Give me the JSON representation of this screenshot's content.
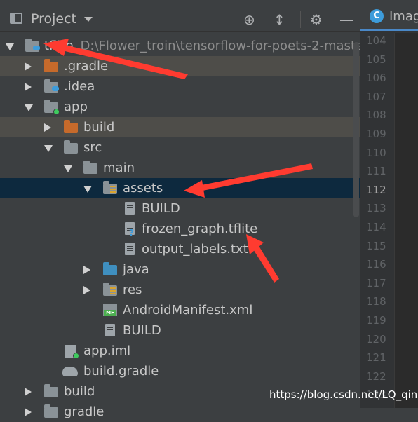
{
  "toolbar": {
    "title": "Project",
    "icons": [
      "view-icon",
      "locate-icon",
      "collapse-icon",
      "gear-icon",
      "minimize-icon"
    ]
  },
  "tree": {
    "root": {
      "label": "tflite",
      "path": "D:\\Flower_troin\\tensorflow-for-poets-2-maste"
    },
    "gradle_dir": ".gradle",
    "idea_dir": ".idea",
    "app": "app",
    "app_build": "build",
    "src": "src",
    "main": "main",
    "assets": "assets",
    "assets_build": "BUILD",
    "frozen_graph": "frozen_graph.tflite",
    "output_labels": "output_labels.txt",
    "java": "java",
    "res": "res",
    "manifest": "AndroidManifest.xml",
    "main_build": "BUILD",
    "app_iml": "app.iml",
    "build_gradle": "build.gradle",
    "root_build": "build",
    "gradle_partial": "gradle"
  },
  "editor": {
    "tab_label": "Imag",
    "tab_icon_letter": "C",
    "line_numbers": [
      "104",
      "105",
      "106",
      "107",
      "108",
      "109",
      "110",
      "111",
      "112",
      "113",
      "114",
      "115",
      "116",
      "117",
      "118",
      "119",
      "120",
      "121",
      "122",
      "123"
    ],
    "current_line": "112"
  },
  "watermark": "https://blog.csdn.net/LQ_qing",
  "colors": {
    "background": "#3c3f41",
    "selection": "#0d293e",
    "highlight": "#4e4d49",
    "annotation_arrow": "#ff3b30"
  }
}
